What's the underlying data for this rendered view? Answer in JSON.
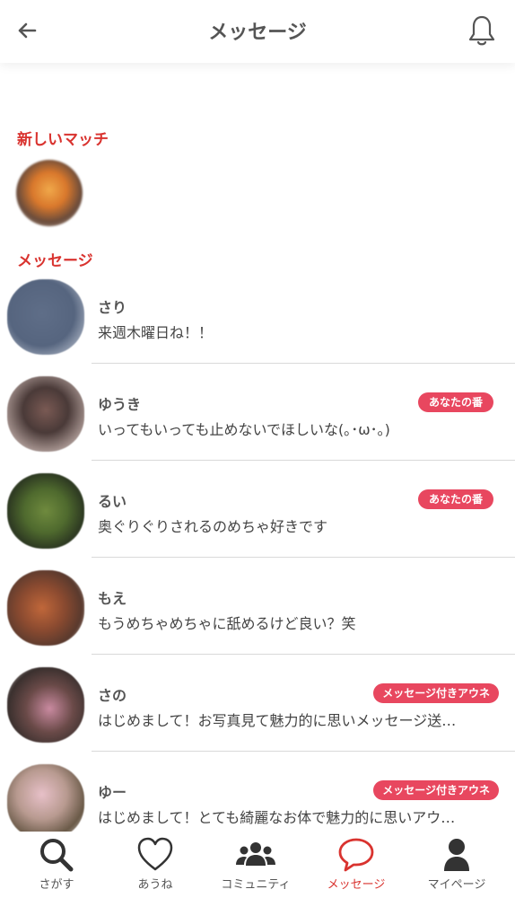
{
  "header": {
    "title": "メッセージ",
    "back_icon": "arrow-left-icon",
    "bell_icon": "bell-icon"
  },
  "sections": {
    "new_matches": "新しいマッチ",
    "messages": "メッセージ"
  },
  "colors": {
    "accent_red": "#d9332f",
    "badge_pink": "#e8475f"
  },
  "conversations": [
    {
      "name": "さり",
      "message": "来週木曜日ね！！",
      "badge": ""
    },
    {
      "name": "ゆうき",
      "message": "いってもいっても止めないでほしいな(｡･ω･｡)",
      "badge": "あなたの番"
    },
    {
      "name": "るい",
      "message": "奥ぐりぐりされるのめちゃ好きです",
      "badge": "あなたの番"
    },
    {
      "name": "もえ",
      "message": "もうめちゃめちゃに舐めるけど良い？笑",
      "badge": ""
    },
    {
      "name": "さの",
      "message": "はじめまして！お写真見て魅力的に思いメッセージ送…",
      "badge": "メッセージ付きアウネ"
    },
    {
      "name": "ゆー",
      "message": "はじめまして！とても綺麗なお体で魅力的に思いアウ…",
      "badge": "メッセージ付きアウネ"
    }
  ],
  "tabbar": {
    "tabs": [
      {
        "label": "さがす",
        "icon": "search-icon"
      },
      {
        "label": "あうね",
        "icon": "heart-icon"
      },
      {
        "label": "コミュニティ",
        "icon": "community-icon"
      },
      {
        "label": "メッセージ",
        "icon": "message-bubble-icon"
      },
      {
        "label": "マイページ",
        "icon": "person-icon"
      }
    ],
    "active": "メッセージ"
  }
}
